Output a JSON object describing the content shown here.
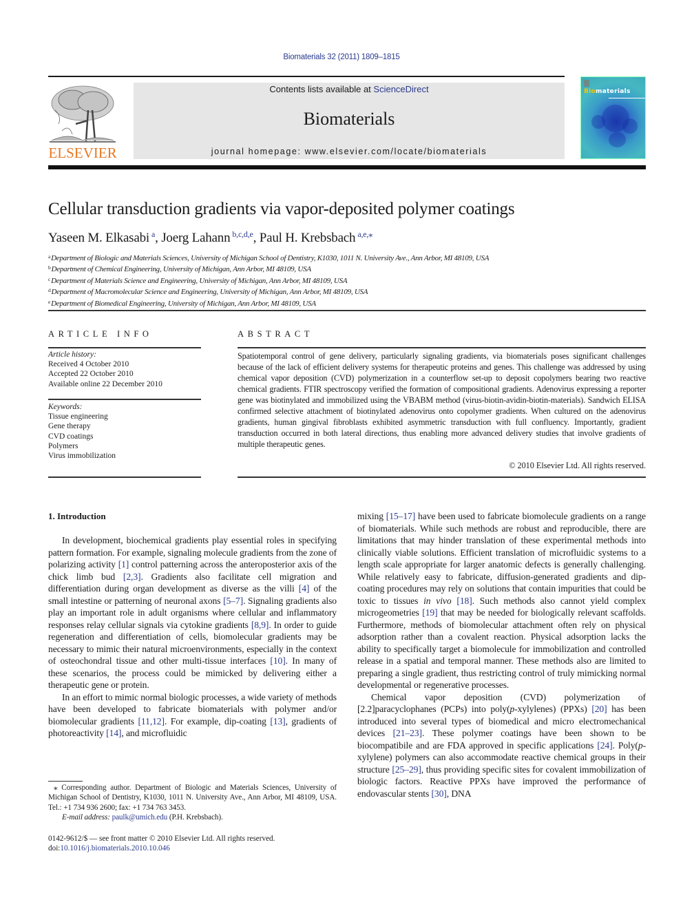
{
  "header": {
    "citation": "Biomaterials 32 (2011) 1809–1815",
    "contents_prefix": "Contents lists available at ",
    "contents_link": "ScienceDirect",
    "journal_title": "Biomaterials",
    "homepage": "journal homepage: www.elsevier.com/locate/biomaterials",
    "publisher_logo_text": "ELSEVIER",
    "cover": {
      "title_highlight": "Bio",
      "title_rest": "materials"
    }
  },
  "colors": {
    "link": "#2b3a8e",
    "publisher_orange": "#e87722",
    "banner_bg": "#e6e6e6"
  },
  "article": {
    "title": "Cellular transduction gradients via vapor-deposited polymer coatings",
    "authors": [
      {
        "name": "Yaseen M. Elkasabi",
        "affil": "a",
        "sep": ", "
      },
      {
        "name": "Joerg Lahann",
        "affil": "b,c,d,e",
        "sep": ", "
      },
      {
        "name": "Paul H. Krebsbach",
        "affil": "a,e,⁎",
        "sep": ""
      }
    ],
    "affiliations": [
      {
        "key": "a",
        "text": "Department of Biologic and Materials Sciences, University of Michigan School of Dentistry, K1030, 1011 N. University Ave., Ann Arbor, MI 48109, USA"
      },
      {
        "key": "b",
        "text": "Department of Chemical Engineering, University of Michigan, Ann Arbor, MI 48109, USA"
      },
      {
        "key": "c",
        "text": "Department of Materials Science and Engineering, University of Michigan, Ann Arbor, MI 48109, USA"
      },
      {
        "key": "d",
        "text": "Department of Macromolecular Science and Engineering, University of Michigan, Ann Arbor, MI 48109, USA"
      },
      {
        "key": "e",
        "text": "Department of Biomedical Engineering, University of Michigan, Ann Arbor, MI 48109, USA"
      }
    ]
  },
  "article_info": {
    "heading": "ARTICLE INFO",
    "history_label": "Article history:",
    "history": [
      "Received 4 October 2010",
      "Accepted 22 October 2010",
      "Available online 22 December 2010"
    ],
    "keywords_label": "Keywords:",
    "keywords": [
      "Tissue engineering",
      "Gene therapy",
      "CVD coatings",
      "Polymers",
      "Virus immobilization"
    ]
  },
  "abstract": {
    "heading": "ABSTRACT",
    "text": "Spatiotemporal control of gene delivery, particularly signaling gradients, via biomaterials poses significant challenges because of the lack of efficient delivery systems for therapeutic proteins and genes. This challenge was addressed by using chemical vapor deposition (CVD) polymerization in a counterflow set-up to deposit copolymers bearing two reactive chemical gradients. FTIR spectroscopy verified the formation of compositional gradients. Adenovirus expressing a reporter gene was biotinylated and immobilized using the VBABM method (virus-biotin-avidin-biotin-materials). Sandwich ELISA confirmed selective attachment of biotinylated adenovirus onto copolymer gradients. When cultured on the adenovirus gradients, human gingival fibroblasts exhibited asymmetric transduction with full confluency. Importantly, gradient transduction occurred in both lateral directions, thus enabling more advanced delivery studies that involve gradients of multiple therapeutic genes.",
    "copyright": "© 2010 Elsevier Ltd. All rights reserved."
  },
  "body": {
    "section_heading": "1.  Introduction",
    "left_paragraphs": [
      [
        {
          "t": "In development, biochemical gradients play essential roles in specifying pattern formation. For example, signaling molecule gradients from the zone of polarizing activity "
        },
        {
          "ref": "[1]"
        },
        {
          "t": " control patterning across the anteroposterior axis of the chick limb bud "
        },
        {
          "ref": "[2,3]"
        },
        {
          "t": ". Gradients also facilitate cell migration and differentiation during organ development as diverse as the villi "
        },
        {
          "ref": "[4]"
        },
        {
          "t": " of the small intestine or patterning of neuronal axons "
        },
        {
          "ref": "[5–7]"
        },
        {
          "t": ". Signaling gradients also play an important role in adult organisms where cellular and inflammatory responses relay cellular signals via cytokine gradients "
        },
        {
          "ref": "[8,9]"
        },
        {
          "t": ". In order to guide regeneration and differentiation of cells, biomolecular gradients may be necessary to mimic their natural microenvironments, especially in the context of osteochondral tissue and other multi-tissue interfaces "
        },
        {
          "ref": "[10]"
        },
        {
          "t": ". In many of these scenarios, the process could be mimicked by delivering either a therapeutic gene or protein."
        }
      ],
      [
        {
          "t": "In an effort to mimic normal biologic processes, a wide variety of methods have been developed to fabricate biomaterials with polymer and/or biomolecular gradients "
        },
        {
          "ref": "[11,12]"
        },
        {
          "t": ". For example, dip-coating "
        },
        {
          "ref": "[13]"
        },
        {
          "t": ", gradients of photoreactivity "
        },
        {
          "ref": "[14]"
        },
        {
          "t": ", and microfluidic"
        }
      ]
    ],
    "right_paragraphs": [
      [
        {
          "t": "mixing "
        },
        {
          "ref": "[15–17]"
        },
        {
          "t": " have been used to fabricate biomolecule gradients on a range of biomaterials. While such methods are robust and reproducible, there are limitations that may hinder translation of these experimental methods into clinically viable solutions. Efficient translation of microfluidic systems to a length scale appropriate for larger anatomic defects is generally challenging. While relatively easy to fabricate, diffusion-generated gradients and dip-coating procedures may rely on solutions that contain impurities that could be toxic to tissues "
        },
        {
          "i": "in vivo"
        },
        {
          "t": " "
        },
        {
          "ref": "[18]"
        },
        {
          "t": ". Such methods also cannot yield complex microgeometries "
        },
        {
          "ref": "[19]"
        },
        {
          "t": " that may be needed for biologically relevant scaffolds. Furthermore, methods of biomolecular attachment often rely on physical adsorption rather than a covalent reaction. Physical adsorption lacks the ability to specifically target a biomolecule for immobilization and controlled release in a spatial and temporal manner. These methods also are limited to preparing a single gradient, thus restricting control of truly mimicking normal developmental or regenerative processes."
        }
      ],
      [
        {
          "t": "Chemical vapor deposition (CVD) polymerization of [2.2]paracyclophanes (PCPs) into poly("
        },
        {
          "i": "p"
        },
        {
          "t": "-xylylenes) (PPXs) "
        },
        {
          "ref": "[20]"
        },
        {
          "t": " has been introduced into several types of biomedical and micro electromechanical devices "
        },
        {
          "ref": "[21–23]"
        },
        {
          "t": ". These polymer coatings have been shown to be biocompatibile and are FDA approved in specific applications "
        },
        {
          "ref": "[24]"
        },
        {
          "t": ". Poly("
        },
        {
          "i": "p"
        },
        {
          "t": "-xylylene) polymers can also accommodate reactive chemical groups in their structure "
        },
        {
          "ref": "[25–29]"
        },
        {
          "t": ", thus providing specific sites for covalent immobilization of biologic factors. Reactive PPXs have improved the performance of endovascular stents "
        },
        {
          "ref": "[30]"
        },
        {
          "t": ", DNA"
        }
      ]
    ]
  },
  "footnotes": {
    "corresponding": "⁎ Corresponding author. Department of Biologic and Materials Sciences, University of Michigan School of Dentistry, K1030, 1011 N. University Ave., Ann Arbor, MI 48109, USA. Tel.: +1 734 936 2600; fax: +1 734 763 3453.",
    "email_label": "E-mail address:",
    "email": "paulk@umich.edu",
    "email_suffix": " (P.H. Krebsbach).",
    "issn_line": "0142-9612/$ — see front matter © 2010 Elsevier Ltd. All rights reserved.",
    "doi_label": "doi:",
    "doi": "10.1016/j.biomaterials.2010.10.046"
  }
}
